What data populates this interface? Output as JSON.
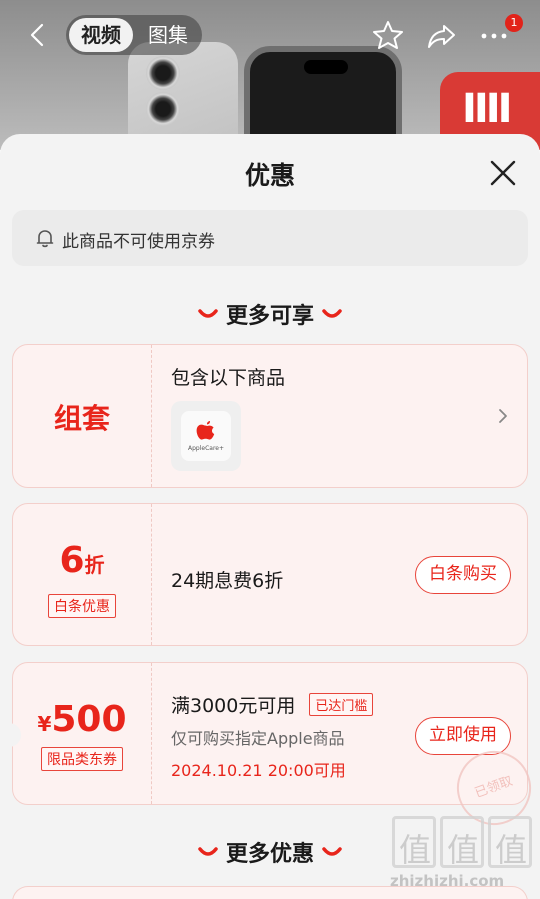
{
  "top_nav": {
    "tabs": [
      "视频",
      "图集"
    ],
    "active_tab": "视频",
    "notification_count": "1",
    "icons": [
      "back-icon",
      "star-icon",
      "share-icon",
      "more-icon"
    ],
    "brand_logo_text": "IIII"
  },
  "sheet": {
    "title": "优惠",
    "notice": "此商品不可使用京券",
    "section1_title": "更多可享",
    "bundle": {
      "label": "组套",
      "heading": "包含以下商品",
      "product_name": "AppleCare+"
    },
    "installment": {
      "discount_number": "6",
      "discount_unit": "折",
      "tag": "白条优惠",
      "desc": "24期息费6折",
      "button": "白条购买"
    },
    "coupon": {
      "currency": "¥",
      "amount": "500",
      "tag": "限品类东券",
      "condition": "满3000元可用",
      "threshold_tag": "已达门槛",
      "scope": "仅可购买指定Apple商品",
      "valid_time": "2024.10.21 20:00可用",
      "button": "立即使用",
      "stamp": "已领取"
    },
    "section2_title": "更多优惠"
  },
  "watermark": {
    "chars": [
      "值",
      "值",
      "值"
    ],
    "url": "zhizhizhi.com"
  },
  "colors": {
    "accent": "#e8251b",
    "card_bg": "#fdf2f1",
    "sheet_bg": "#f3f3f3"
  }
}
